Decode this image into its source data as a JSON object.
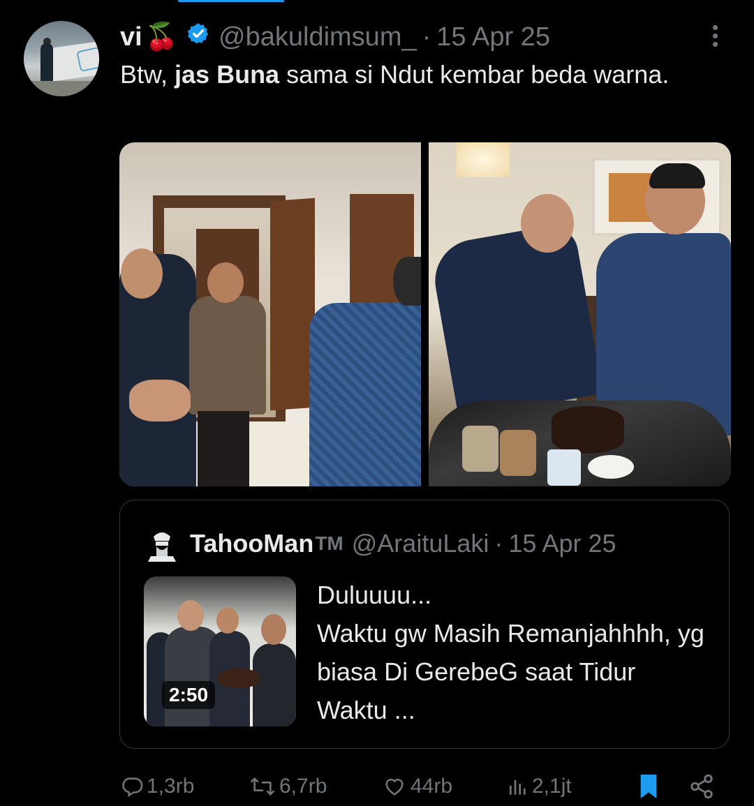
{
  "colors": {
    "accent": "#1d9bf0",
    "muted": "#71767b",
    "text": "#e7e9ea",
    "background": "#000000"
  },
  "tweet": {
    "author_name": "vi",
    "author_emoji": "🍒",
    "verified_icon": "verified-badge-icon",
    "handle": "@bakuldimsum_",
    "separator": "·",
    "date": "15 Apr 25",
    "text_parts": [
      "Btw, ",
      "jas Buna",
      " sama si Ndut kembar beda warna."
    ]
  },
  "quote": {
    "author_name": "TahooMan",
    "tm": "TM",
    "handle": "@AraituLaki",
    "separator": "·",
    "date": "15 Apr 25",
    "video_duration": "2:50",
    "text": "Duluuuu...\nWaktu gw Masih Remanjahhhh, yg biasa Di GerebeG saat Tidur Waktu ..."
  },
  "actions": {
    "replies": "1,3rb",
    "reposts": "6,7rb",
    "likes": "44rb",
    "views": "2,1jt"
  },
  "icons": [
    "more-icon",
    "reply-icon",
    "repost-icon",
    "like-icon",
    "views-icon",
    "bookmark-icon",
    "share-icon"
  ]
}
